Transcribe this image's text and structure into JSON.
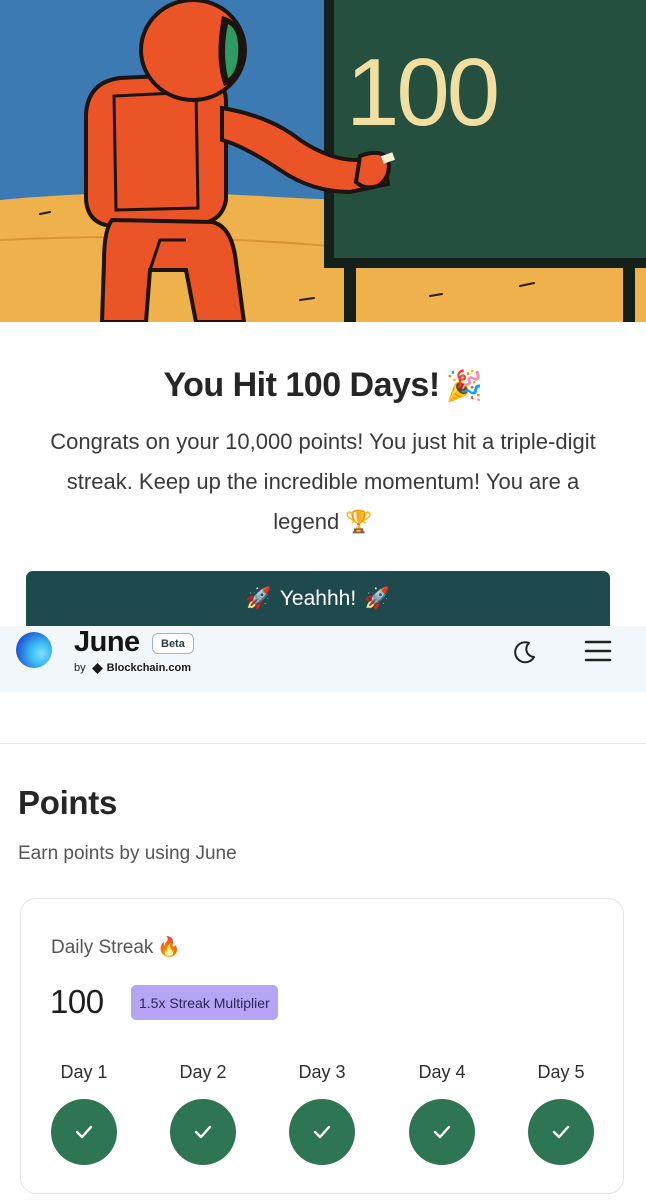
{
  "modal": {
    "board_number": "100",
    "title": "You Hit 100 Days!",
    "title_emoji": "🎉",
    "message": "Congrats on your 10,000 points! You just hit a triple-digit streak. Keep up the incredible momentum! You are a legend 🏆",
    "button_label": "Yeahhh!",
    "button_emoji": "🚀"
  },
  "header": {
    "brand": "June",
    "badge": "Beta",
    "byline_prefix": "by",
    "byline_company": "Blockchain.com",
    "icons": [
      "june-logo-icon",
      "blockchain-logo-icon",
      "moon-icon",
      "menu-icon"
    ]
  },
  "points": {
    "title": "Points",
    "subtitle": "Earn points by using June",
    "streak": {
      "label": "Daily Streak",
      "label_emoji": "🔥",
      "count": "100",
      "multiplier": "1.5x Streak Multiplier",
      "days": [
        {
          "label": "Day 1",
          "done": true
        },
        {
          "label": "Day 2",
          "done": true
        },
        {
          "label": "Day 3",
          "done": true
        },
        {
          "label": "Day 4",
          "done": true
        },
        {
          "label": "Day 5",
          "done": true
        }
      ]
    }
  },
  "colors": {
    "button_bg": "#1e4a4e",
    "check_bg": "#2e7554",
    "multiplier_bg": "#b6a4f4",
    "header_bg": "#f1f7fb",
    "board_green": "#25503f",
    "astronaut_orange": "#ea5426"
  }
}
